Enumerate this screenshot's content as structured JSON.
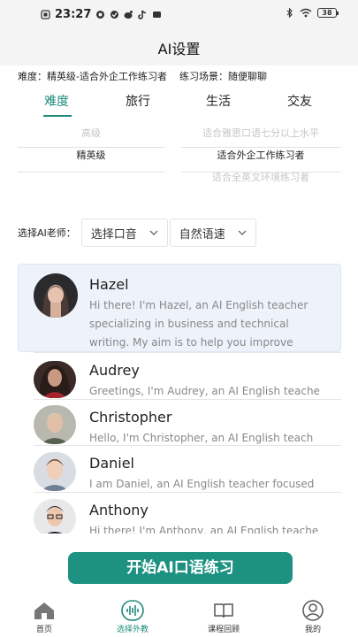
{
  "status_bar": {
    "time": "23:27",
    "battery": "38"
  },
  "header": {
    "title": "AI设置"
  },
  "summary": {
    "difficulty_text": "难度：精英级-适合外企工作练习者",
    "scene_text": "练习场景：随便聊聊"
  },
  "tabs": [
    "难度",
    "旅行",
    "生活",
    "交友"
  ],
  "level_picker": {
    "above": "高级",
    "selected": "精英级",
    "below": ""
  },
  "desc_picker": {
    "above": "适合雅思口语七分以上水平",
    "selected": "适合外企工作练习者",
    "below": "适合全英文环境练习者"
  },
  "teacher_selector": {
    "label": "选择AI老师：",
    "accent_label": "选择口音",
    "speed_label": "自然语速"
  },
  "teachers": [
    {
      "name": "Hazel",
      "intro": "Hi there! I'm Hazel, an AI English teacher specializing in business and technical writing. My aim is to help you improve"
    },
    {
      "name": "Audrey",
      "intro": "Greetings, I'm Audrey, an AI English teache"
    },
    {
      "name": "Christopher",
      "intro": "Hello, I'm Christopher, an AI English teach"
    },
    {
      "name": "Daniel",
      "intro": "I am Daniel, an AI English teacher focused"
    },
    {
      "name": "Anthony",
      "intro": "Hi there! I'm Anthony, an AI English teache"
    }
  ],
  "start_button": {
    "label": "开始AI口语练习"
  },
  "bottom_nav": [
    {
      "label": "首页",
      "icon": "home-icon"
    },
    {
      "label": "选择外教",
      "icon": "voice-wave-icon"
    },
    {
      "label": "课程回顾",
      "icon": "book-icon"
    },
    {
      "label": "我的",
      "icon": "profile-icon"
    }
  ],
  "colors": {
    "accent": "#1f8b7b",
    "button": "#1e9282",
    "selected_card": "#eef2fb"
  }
}
